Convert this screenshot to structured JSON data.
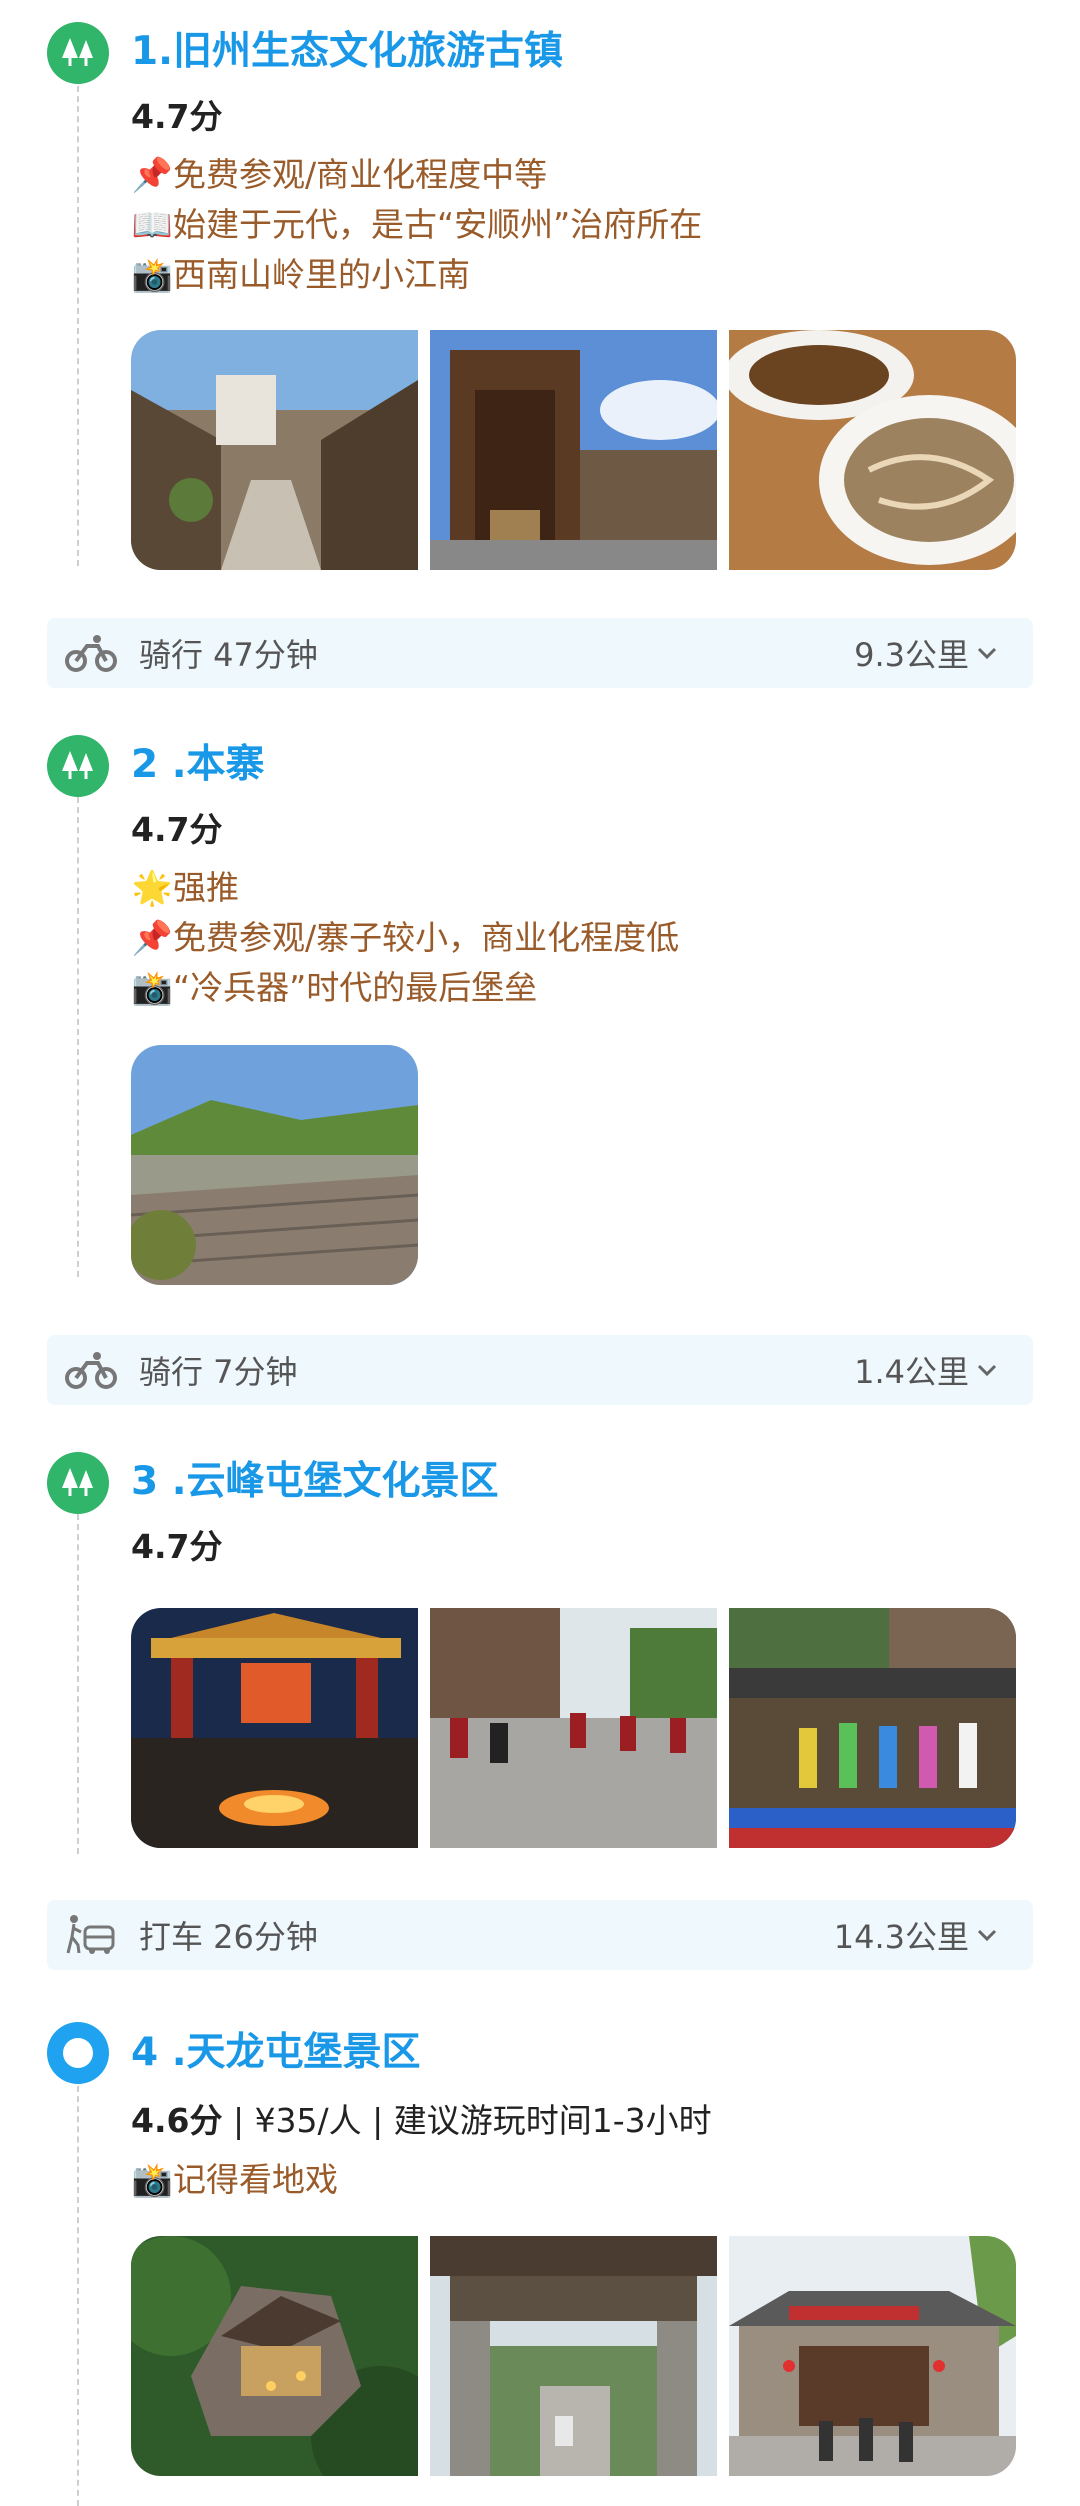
{
  "spots": [
    {
      "title": "1.旧州生态文化旅游古镇",
      "rating": "4.7分",
      "lines": [
        {
          "icon": "pin-icon",
          "emoji": "📌",
          "text": "免费参观/商业化程度中等"
        },
        {
          "icon": "book-icon",
          "emoji": "📖",
          "text": "始建于元代，是古“安顺州”治府所在"
        },
        {
          "icon": "camera-icon",
          "emoji": "📸",
          "text": "西南山岭里的小江南"
        }
      ],
      "photo_count": 3
    },
    {
      "title": "2 .本寨",
      "rating": "4.7分",
      "lines": [
        {
          "icon": "star-icon",
          "emoji": "🌟",
          "text": "强推"
        },
        {
          "icon": "pin-icon",
          "emoji": "📌",
          "text": "免费参观/寨子较小，商业化程度低"
        },
        {
          "icon": "camera-icon",
          "emoji": "📸",
          "text": "“冷兵器”时代的最后堡垒"
        }
      ],
      "photo_count": 1
    },
    {
      "title": "3 .云峰屯堡文化景区",
      "rating": "4.7分",
      "lines": [],
      "photo_count": 3
    },
    {
      "title": "4 .天龙屯堡景区",
      "rating": "4.6分",
      "rating_extra": " | ¥35/人 | 建议游玩时间1-3小时",
      "lines": [
        {
          "icon": "camera-icon",
          "emoji": "📸",
          "text": "记得看地戏"
        }
      ],
      "photo_count": 3
    }
  ],
  "transports": [
    {
      "icon": "bike-icon",
      "mode": "骑行 47分钟",
      "distance": "9.3公里"
    },
    {
      "icon": "bike-icon",
      "mode": "骑行 7分钟",
      "distance": "1.4公里"
    },
    {
      "icon": "taxi-icon",
      "mode": "打车 26分钟",
      "distance": "14.3公里"
    }
  ],
  "colors": {
    "title": "#1a98e8",
    "badge_green": "#30b56a",
    "badge_blue": "#1fa3f0",
    "tagline": "#9a5b2a",
    "transport_bg": "#eef8fd"
  }
}
